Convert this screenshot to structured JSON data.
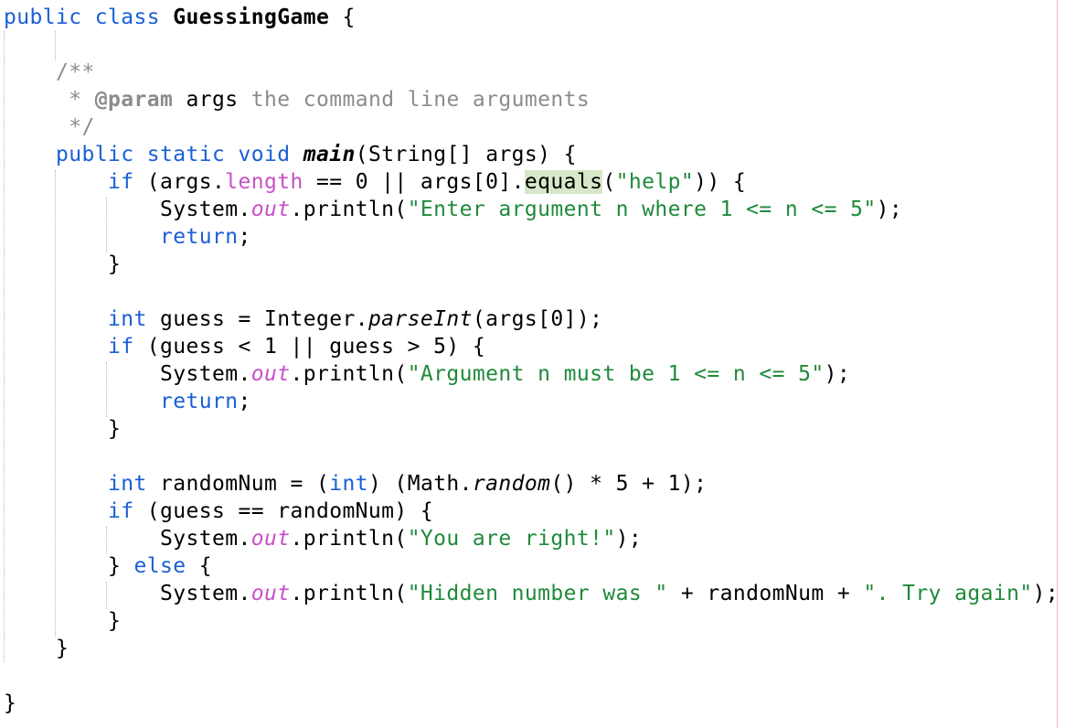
{
  "editor": {
    "language": "java",
    "colors": {
      "keyword": "#1a5fd6",
      "field": "#c84fc8",
      "string": "#1f8a3a",
      "comment": "#8c8c8c",
      "highlight": "#d6e8c9",
      "right_margin": "#e7b6d8"
    },
    "lines": [
      [
        "public",
        " ",
        "class",
        " ",
        "GuessingGame",
        " {"
      ],
      [],
      [
        "    ",
        "/**"
      ],
      [
        "     ",
        "* ",
        "@param",
        " ",
        "args",
        " the command line arguments"
      ],
      [
        "     ",
        "*/"
      ],
      [
        "    ",
        "public",
        " ",
        "static",
        " ",
        "void",
        " ",
        "main",
        "(String[] args) {"
      ],
      [
        "        ",
        "if",
        " (args.",
        "length",
        " == 0 || args[0].",
        "equals",
        "(",
        "\"help\"",
        ")) {"
      ],
      [
        "            ",
        "System.",
        "out",
        ".println(",
        "\"Enter argument n where 1 <= n <= 5\"",
        ");"
      ],
      [
        "            ",
        "return",
        ";"
      ],
      [
        "        ",
        "}"
      ],
      [],
      [
        "        ",
        "int",
        " guess = Integer.",
        "parseInt",
        "(args[0]);"
      ],
      [
        "        ",
        "if",
        " (guess < 1 || guess > 5) {"
      ],
      [
        "            ",
        "System.",
        "out",
        ".println(",
        "\"Argument n must be 1 <= n <= 5\"",
        ");"
      ],
      [
        "            ",
        "return",
        ";"
      ],
      [
        "        ",
        "}"
      ],
      [],
      [
        "        ",
        "int",
        " randomNum = (",
        "int",
        ") (Math.",
        "random",
        "() * 5 + 1);"
      ],
      [
        "        ",
        "if",
        " (guess == randomNum) {"
      ],
      [
        "            ",
        "System.",
        "out",
        ".println(",
        "\"You are right!\"",
        ");"
      ],
      [
        "        ",
        "} ",
        "else",
        " {"
      ],
      [
        "            ",
        "System.",
        "out",
        ".println(",
        "\"Hidden number was \"",
        " + randomNum + ",
        "\". Try again\"",
        ");"
      ],
      [
        "        ",
        "}"
      ],
      [
        "    ",
        "}"
      ],
      [],
      [
        "}"
      ]
    ]
  }
}
